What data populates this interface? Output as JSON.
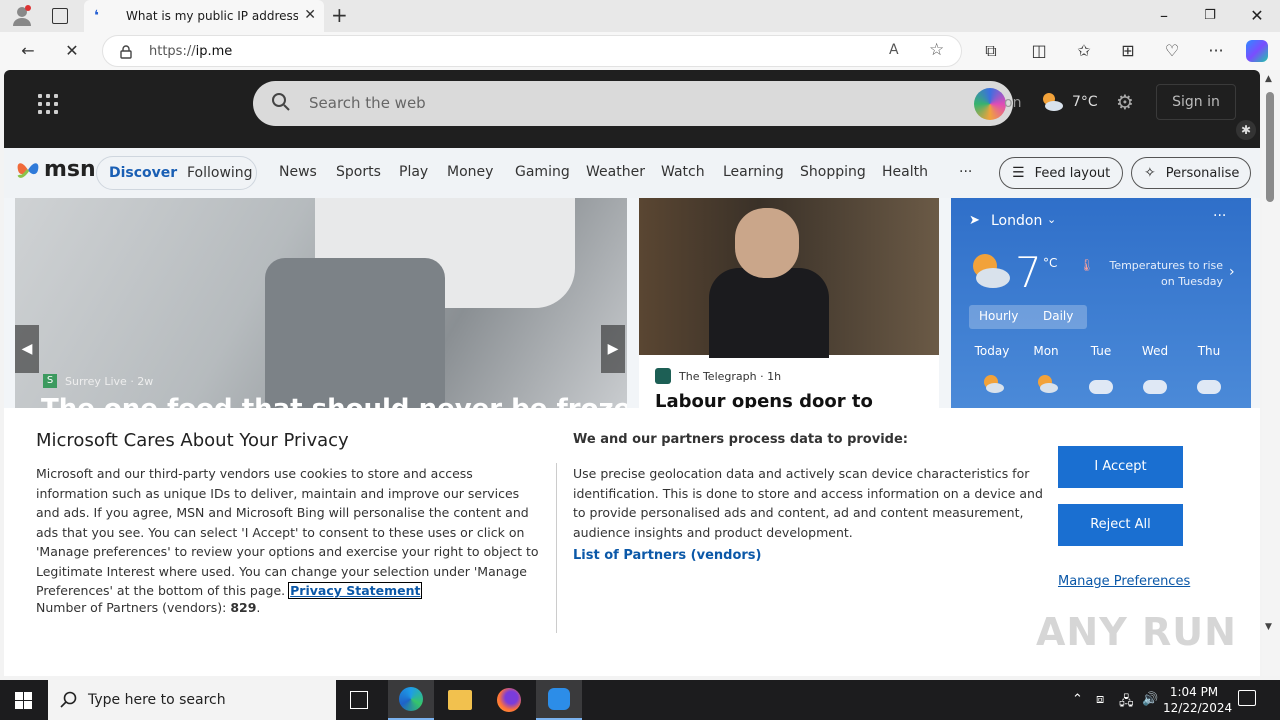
{
  "browser": {
    "tab_title": "What is my public IP address - IP",
    "url_prefix": "https://",
    "url_host": "ip.me"
  },
  "msn": {
    "search_placeholder": "Search the web",
    "header_city_fragment": "on",
    "header_temp": "7°C",
    "sign_in": "Sign in",
    "logo_text": "msn",
    "tabs": {
      "discover": "Discover",
      "following": "Following"
    },
    "nav": [
      "News",
      "Sports",
      "Play",
      "Money",
      "Gaming",
      "Weather",
      "Watch",
      "Learning",
      "Shopping",
      "Health",
      "···"
    ],
    "feed_layout": "Feed layout",
    "personalise": "Personalise",
    "hero": {
      "source": "Surrey Live",
      "time": "· 2w",
      "source_initial": "S",
      "headline": "The one food that should never be frozen"
    },
    "card2": {
      "source": "The Telegraph",
      "time": "· 1h",
      "headline": "Labour opens door to"
    },
    "weather": {
      "city": "London",
      "temp": "7",
      "unit": "°C",
      "note": "Temperatures to rise on Tuesday",
      "hourly": "Hourly",
      "daily": "Daily",
      "days": [
        "Today",
        "Mon",
        "Tue",
        "Wed",
        "Thu"
      ]
    }
  },
  "privacy": {
    "title": "Microsoft Cares About Your Privacy",
    "body": "Microsoft and our third-party vendors use cookies to store and access information such as unique IDs to deliver, maintain and improve our services and ads. If you agree, MSN and Microsoft Bing will personalise the content and ads that you see. You can select 'I Accept' to consent to these uses or click on 'Manage preferences' to review your options and exercise your right to object to Legitimate Interest where used.  You can change your selection under 'Manage Preferences' at the bottom of this page.",
    "privacy_link": "Privacy Statement",
    "partners_label": "Number of Partners (vendors):",
    "partners_count": "829",
    "right_title": "We and our partners process data to provide:",
    "right_body": "Use precise geolocation data and actively scan device characteristics for identification. This is done to store and access information on a device and to provide personalised ads and content, ad and content measurement, audience insights and product development.",
    "vendors_link": "List of Partners (vendors)",
    "accept": "I Accept",
    "reject": "Reject All",
    "manage": "Manage Preferences"
  },
  "watermark": "ANY RUN",
  "taskbar": {
    "search_placeholder": "Type here to search",
    "time": "1:04 PM",
    "date": "12/22/2024"
  }
}
